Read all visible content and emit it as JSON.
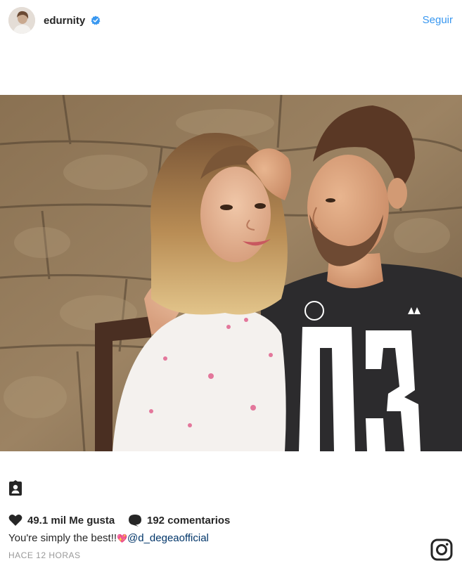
{
  "header": {
    "username": "edurnity",
    "follow_label": "Seguir",
    "verified_icon": "verified-badge-icon",
    "accent_color": "#3897f0"
  },
  "post": {
    "photo_icon": "couple-photo",
    "likes_label": "49.1 mil Me gusta",
    "comments_label": "192 comentarios",
    "caption_text": "You're simply the best!!",
    "caption_emoji": "💖",
    "caption_mention": "@d_degeaofficial",
    "timestamp": "HACE 12 HORAS"
  },
  "icons": {
    "tag": "user-tag-icon",
    "heart": "heart-icon",
    "comment": "comment-icon",
    "brand": "instagram-logo-icon"
  }
}
